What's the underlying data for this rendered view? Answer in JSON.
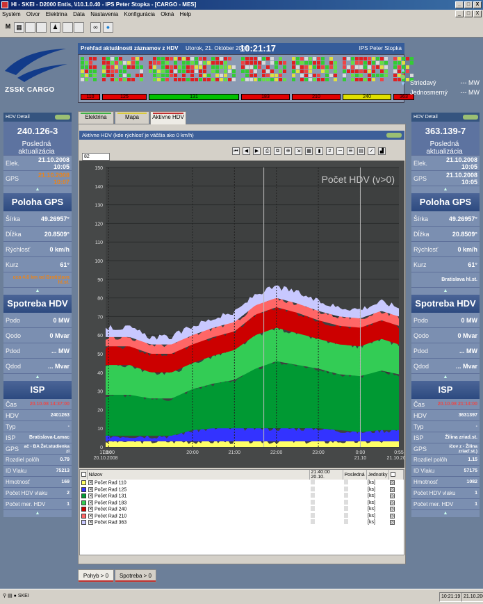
{
  "window": {
    "title": "HI - SKEI - D2000 Entis, \\\\10.1.0.40 - IPS Peter Stopka - [CARGO - MES]",
    "buttons": [
      "_",
      "□",
      "X"
    ],
    "mdi_buttons": [
      "_",
      "□",
      "X"
    ]
  },
  "menu": [
    "Systém",
    "Otvor",
    "Elektrina",
    "Dáta",
    "Nastavenia",
    "Konfigurácia",
    "Okná",
    "Help"
  ],
  "logo": {
    "text": "ZSSK CARGO"
  },
  "overview": {
    "title": "Prehľad aktuálnosti záznamov z HDV",
    "date": "Utorok, 21. Október 2008",
    "time": "10:21:17",
    "user": "IPS Peter Stopka",
    "groups": [
      {
        "label": "110",
        "bar_color": "#e00000"
      },
      {
        "label": "125",
        "bar_color": "#e00000"
      },
      {
        "label": "131",
        "bar_color": "#00c000"
      },
      {
        "label": "183",
        "bar_color": "#e00000"
      },
      {
        "label": "210",
        "bar_color": "#e00000"
      },
      {
        "label": "240",
        "bar_color": "#e0e000"
      },
      {
        "label": "363",
        "bar_color": "#e00000"
      }
    ]
  },
  "power": {
    "rows": [
      {
        "label": "Striedavý",
        "value": "--- MW"
      },
      {
        "label": "Jednosmerný",
        "value": "--- MW"
      }
    ]
  },
  "left_panel": {
    "header": "HDV Detail",
    "vehicle_id": "240.126-3",
    "last_update_label": "Posledná aktualizácia",
    "elek_label": "Elek.",
    "elek_value": "21.10.2008 10:05",
    "gps_label": "GPS",
    "gps_value": "21.10.2008 10:07",
    "gps_section": "Poloha GPS",
    "sirka_label": "Šírka",
    "sirka_value": "49.26957°",
    "dlzka_label": "Dĺžka",
    "dlzka_value": "20.8509°",
    "rychlost_label": "Rýchlosť",
    "rychlost_value": "0 km/h",
    "kurz_label": "Kurz",
    "kurz_value": "61°",
    "location_value": "cca 4.6 km od Bratislava hl.st.",
    "spotreba_section": "Spotreba HDV",
    "podo_label": "Podo",
    "podo_value": "0 MW",
    "qodo_label": "Qodo",
    "qodo_value": "0 Mvar",
    "pdod_label": "Pdod",
    "pdod_value": "...   MW",
    "qdod_label": "Qdod",
    "qdod_value": "...   Mvar",
    "isp_section": "ISP",
    "cas_label": "Čas",
    "cas_value": "20.10.08 14:37:00",
    "hdv_label": "HDV",
    "hdv_value": "2401263",
    "typ_label": "Typ",
    "typ_value": "-",
    "isp_label": "ISP",
    "isp_value": "Bratislava-Lamac",
    "gps2_label": "GPS",
    "gps2_value": "ač - BA Žel.studienka zi",
    "rozdiel_label": "Rozdiel polôh",
    "rozdiel_value": "0.79",
    "vlak_label": "ID Vlaku",
    "vlak_value": "75213",
    "hmotnost_label": "Hmotnosť",
    "hmotnost_value": "169",
    "pocet_label": "Počet HDV vlaku",
    "pocet_value": "2",
    "pocetmer_label": "Počet mer. HDV",
    "pocetmer_value": "1"
  },
  "right_panel": {
    "header": "HDV Detail",
    "vehicle_id": "363.139-7",
    "last_update_label": "Posledná aktualizácia",
    "elek_label": "Elek.",
    "elek_value": "21.10.2008 10:05",
    "gps_label": "GPS",
    "gps_value": "21.10.2008 10:05",
    "gps_section": "Poloha GPS",
    "sirka_label": "Šírka",
    "sirka_value": "49.26957°",
    "dlzka_label": "Dĺžka",
    "dlzka_value": "20.8509°",
    "rychlost_label": "Rýchlosť",
    "rychlost_value": "0 km/h",
    "kurz_label": "Kurz",
    "kurz_value": "61°",
    "location_value": "Bratislava hl.st.",
    "spotreba_section": "Spotreba HDV",
    "podo_label": "Podo",
    "podo_value": "0 MW",
    "qodo_label": "Qodo",
    "qodo_value": "0 Mvar",
    "pdod_label": "Pdod",
    "pdod_value": "...   MW",
    "qdod_label": "Qdod",
    "qdod_value": "...   Mvar",
    "isp_section": "ISP",
    "cas_label": "Čas",
    "cas_value": "20.10.08 21:14:00",
    "hdv_label": "HDV",
    "hdv_value": "3631397",
    "typ_label": "Typ",
    "typ_value": "-",
    "isp_label": "ISP",
    "isp_value": "Žilina zriad.st.",
    "gps2_label": "GPS",
    "gps2_value": "íčov z - Žilina zriaď.st.)",
    "rozdiel_label": "Rozdiel polôh",
    "rozdiel_value": "1.15",
    "vlak_label": "ID Vlaku",
    "vlak_value": "57175",
    "hmotnost_label": "Hmotnosť",
    "hmotnost_value": "1082",
    "pocet_label": "Počet HDV vlaku",
    "pocet_value": "1",
    "pocetmer_label": "Počet mer. HDV",
    "pocetmer_value": "1"
  },
  "tabs": [
    {
      "label": "Elektrina",
      "color": "#3cb043"
    },
    {
      "label": "Mapa",
      "color": "#d9c93a"
    },
    {
      "label": "Aktívne HDV",
      "color": "#c03030"
    }
  ],
  "graph": {
    "title": "Aktívne HDV (kde rýchlosť je väčšia ako 0 km/h)",
    "input_value": "82"
  },
  "chart_data": {
    "type": "area",
    "title": "Počet HDV (v>0)",
    "ylim": [
      0,
      150
    ],
    "y_ticks": [
      "0",
      "10",
      "20",
      "30",
      "40",
      "50",
      "60",
      "70",
      "80",
      "90",
      "100",
      "110",
      "120",
      "130",
      "140",
      "150"
    ],
    "x_tick_labels": [
      "17:56",
      "18:00",
      "20:00",
      "21:00",
      "22:00",
      "23:00",
      "0:00",
      "0:55"
    ],
    "x_tick_sublabels": [
      "20.10.2008",
      "",
      "",
      "",
      "",
      "",
      "21.10",
      "21.10.2008"
    ],
    "x_hours": [
      17.93,
      18,
      20,
      21,
      22,
      23,
      24,
      24.92
    ],
    "x": [
      17.93,
      18.5,
      19.0,
      19.5,
      20.0,
      20.5,
      21.0,
      21.5,
      22.0,
      22.5,
      23.0,
      23.5,
      24.0,
      24.5,
      24.92
    ],
    "series": [
      {
        "name": "Počet Rad 110",
        "color": "#ffff66",
        "values": [
          3,
          3,
          3,
          3,
          3,
          3,
          3,
          3,
          3,
          3,
          3,
          3,
          3,
          3,
          3
        ]
      },
      {
        "name": "Počet Rad 125",
        "color": "#3333ff",
        "values": [
          3,
          3,
          3,
          3,
          6,
          7,
          7,
          7,
          7,
          7,
          7,
          6,
          5,
          6,
          6
        ]
      },
      {
        "name": "Počet Rad 131",
        "color": "#009933",
        "values": [
          22,
          22,
          20,
          20,
          22,
          24,
          26,
          32,
          36,
          34,
          32,
          30,
          30,
          32,
          30
        ]
      },
      {
        "name": "Počet Rad 183",
        "color": "#33cc55",
        "values": [
          16,
          16,
          14,
          14,
          14,
          15,
          16,
          18,
          18,
          17,
          16,
          16,
          16,
          17,
          16
        ]
      },
      {
        "name": "Počet Rad 240",
        "color": "#cc0000",
        "values": [
          10,
          10,
          10,
          10,
          10,
          10,
          10,
          11,
          11,
          11,
          10,
          10,
          10,
          10,
          10
        ]
      },
      {
        "name": "Počet Rad 210",
        "color": "#ff6666",
        "values": [
          5,
          5,
          5,
          5,
          5,
          5,
          5,
          5,
          5,
          5,
          5,
          5,
          5,
          5,
          5
        ]
      },
      {
        "name": "Počet Rad 363",
        "color": "#c8c8ff",
        "values": [
          5,
          5,
          4,
          4,
          5,
          5,
          5,
          6,
          6,
          6,
          5,
          5,
          5,
          5,
          5
        ]
      }
    ],
    "grid": true
  },
  "legend": {
    "col_name": "Názov",
    "col_time": "21:40:00 20.10.",
    "col_last": "Posledná",
    "col_unit": "Jednotky",
    "unit": "[ks]"
  },
  "bottom_tabs": [
    {
      "label": "Pohyb > 0",
      "color": "#c03030"
    },
    {
      "label": "Spotreba > 0",
      "color": "#c03030"
    }
  ],
  "status": {
    "app": "SKEI",
    "time": "10:21:19",
    "date": "21.10.2008"
  }
}
